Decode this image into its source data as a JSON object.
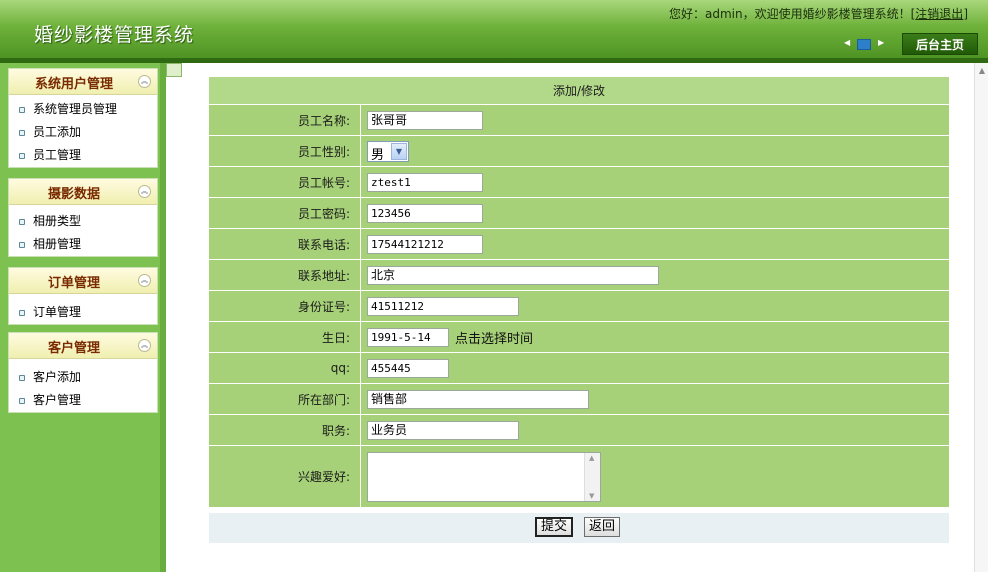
{
  "header": {
    "app_title": "婚纱影楼管理系统",
    "greeting": "您好：admin，欢迎使用婚纱影楼管理系统！",
    "logout_label": "注销退出",
    "home_label": "后台主页"
  },
  "sidebar": {
    "groups": [
      {
        "title": "系统用户管理",
        "items": [
          "系统管理员管理",
          "员工添加",
          "员工管理"
        ]
      },
      {
        "title": "摄影数据",
        "items": [
          "相册类型",
          "相册管理"
        ]
      },
      {
        "title": "订单管理",
        "items": [
          "订单管理"
        ]
      },
      {
        "title": "客户管理",
        "items": [
          "客户添加",
          "客户管理"
        ]
      }
    ]
  },
  "form": {
    "caption": "添加/修改",
    "fields": {
      "name": {
        "label": "员工名称:",
        "value": "张哥哥"
      },
      "gender": {
        "label": "员工性别:",
        "value": "男"
      },
      "account": {
        "label": "员工帐号:",
        "value": "ztest1"
      },
      "password": {
        "label": "员工密码:",
        "value": "123456"
      },
      "phone": {
        "label": "联系电话:",
        "value": "17544121212"
      },
      "address": {
        "label": "联系地址:",
        "value": "北京"
      },
      "idcard": {
        "label": "身份证号:",
        "value": "41511212"
      },
      "birthday": {
        "label": "生日:",
        "value": "1991-5-14",
        "hint": "点击选择时间"
      },
      "qq": {
        "label": "qq:",
        "value": "455445"
      },
      "department": {
        "label": "所在部门:",
        "value": "销售部"
      },
      "position": {
        "label": "职务:",
        "value": "业务员"
      },
      "hobby": {
        "label": "兴趣爱好:",
        "value": ""
      }
    },
    "submit_label": "提交",
    "back_label": "返回"
  },
  "colors": {
    "header_green": "#6fb23b",
    "sidebar_green": "#7dc150",
    "form_row_green": "#a6d178"
  }
}
